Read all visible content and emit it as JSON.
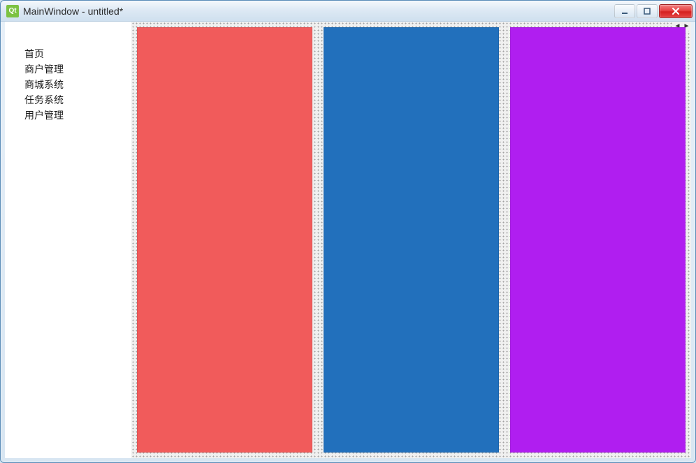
{
  "window": {
    "title": "MainWindow - untitled*",
    "app_icon_label": "Qt"
  },
  "sidebar": {
    "items": [
      {
        "label": "首页"
      },
      {
        "label": "商户管理"
      },
      {
        "label": "商城系统"
      },
      {
        "label": "任务系统"
      },
      {
        "label": "用户管理"
      }
    ]
  },
  "panels": [
    {
      "color": "#f15b5b"
    },
    {
      "color": "#2270bc"
    },
    {
      "color": "#b01ef0"
    }
  ]
}
